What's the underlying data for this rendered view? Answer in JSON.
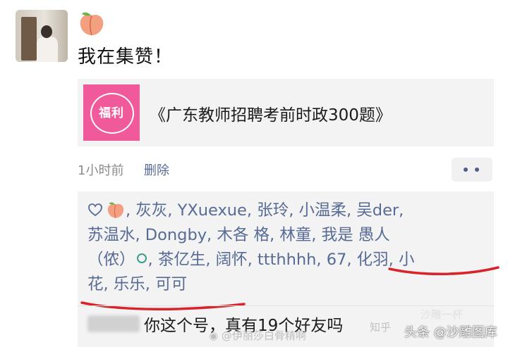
{
  "post": {
    "text": "我在集赞！"
  },
  "share_card": {
    "logo_text": "福利",
    "title": "《广东教师招聘考前时政300题》"
  },
  "meta": {
    "time": "1小时前",
    "delete": "删除"
  },
  "likes": {
    "line1": ", 灰灰, YXuexue, 张玲, 小温柔, 吴der,",
    "line2": "苏温水, Dongby, 木各 格, 林童, 我是 愚人",
    "line3_a": "（侬）",
    "line3_b": ", 茶亿生, 阔怀, ttthhhh, 67, 化羽, 小",
    "line4": "花, 乐乐, 可可"
  },
  "comment": {
    "text": "你这个号，真有19个好友吗"
  },
  "watermarks": {
    "weibo": "@伊丽莎白骨精啊",
    "zhihu": "知乎",
    "toutiao": "头条 @沙雕图库",
    "faint": "沙雕一杯"
  },
  "colors": {
    "link_blue": "#576b95",
    "logo_pink": "#f15a9a",
    "underline_red": "#d8232a",
    "box_gray": "#f3f3f3"
  },
  "icons": [
    "peach-icon",
    "heart-outline-icon",
    "more-dots-icon",
    "weibo-icon"
  ]
}
